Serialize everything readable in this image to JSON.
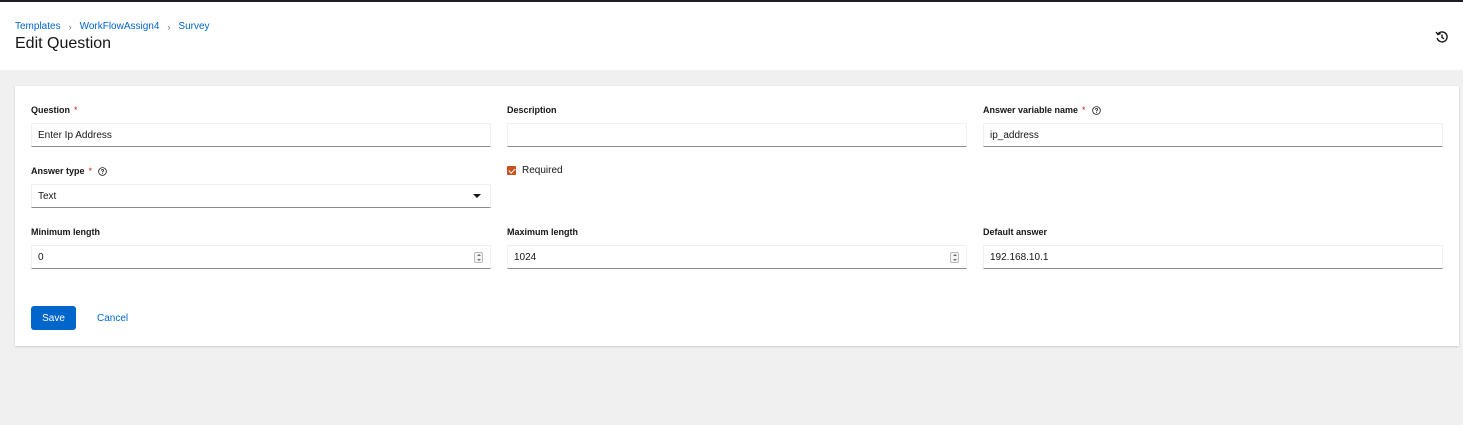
{
  "breadcrumb": [
    "Templates",
    "WorkFlowAssign4",
    "Survey"
  ],
  "page_title": "Edit Question",
  "fields": {
    "question": {
      "label": "Question",
      "value": "Enter Ip Address",
      "required": true
    },
    "description": {
      "label": "Description",
      "value": ""
    },
    "variable_name": {
      "label": "Answer variable name",
      "value": "ip_address",
      "required": true
    },
    "answer_type": {
      "label": "Answer type",
      "value": "Text",
      "required": true
    },
    "required_checkbox": {
      "label": "Required",
      "checked": true
    },
    "min_length": {
      "label": "Minimum length",
      "value": "0"
    },
    "max_length": {
      "label": "Maximum length",
      "value": "1024"
    },
    "default_answer": {
      "label": "Default answer",
      "value": "192.168.10.1"
    }
  },
  "actions": {
    "save": "Save",
    "cancel": "Cancel"
  },
  "required_marker": "*",
  "colors": {
    "link": "#0066cc",
    "primary_button": "#0066cc",
    "required": "#c9190b",
    "checkbox": "#c9521f"
  }
}
